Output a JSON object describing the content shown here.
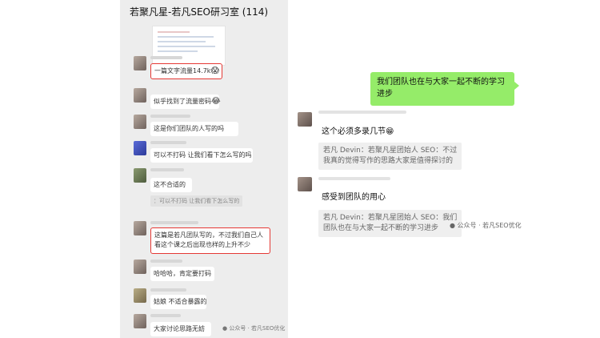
{
  "left": {
    "header_title": "若聚凡星-若凡SEO研习室 (114)",
    "messages": [
      "一篇文字流量14.7k",
      "似乎找到了流量密码",
      "这是你们团队的人写的吗",
      "可以不打码 让我们看下怎么写的吗",
      "这不合适的",
      "：可以不打码 让我们看下怎么写的",
      "这篇是若凡团队写的，不过我们自己人",
      "看这个课之后出现也样的上升不少",
      "哈哈哈，肯定要打码",
      "姑娘 不适合暴露的",
      "大家讨论思路无妨"
    ],
    "emoji_1": "😱",
    "emoji_2": "😂",
    "watermark": "公众号 · 若凡SEO优化"
  },
  "right": {
    "green_message": "我们团队也在与大家一起不断的学习进步",
    "msg1": "这个必须多录几节",
    "msg1_emoji": "😁",
    "quote1_line1": "若凡 Devin：若聚凡星团始人 SEO：不过",
    "quote1_line2": "我真的觉得写作的思路大家是值得探讨的",
    "msg2": "感受到团队的用心",
    "quote2_line1": "若凡 Devin：若聚凡星团始人 SEO：我们",
    "quote2_line2": "团队也在与大家一起不断的学习进步",
    "watermark": "公众号 · 若凡SEO优化"
  }
}
